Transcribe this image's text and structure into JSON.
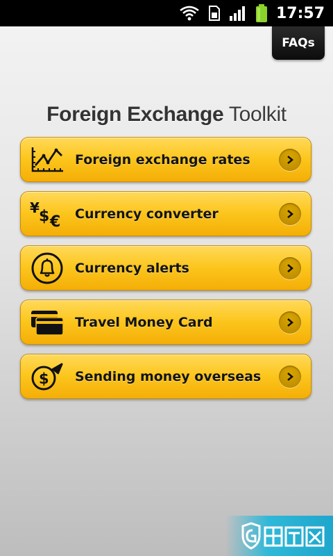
{
  "status_bar": {
    "time": "17:57",
    "icons": [
      "wifi-icon",
      "sim-icon",
      "signal-icon",
      "battery-icon"
    ]
  },
  "header": {
    "faqs_label": "FAQs"
  },
  "title": {
    "bold": "Foreign Exchange",
    "light": "Toolkit"
  },
  "menu": {
    "items": [
      {
        "label": "Foreign exchange rates",
        "icon": "line-chart-icon"
      },
      {
        "label": "Currency converter",
        "icon": "currency-symbols-icon"
      },
      {
        "label": "Currency alerts",
        "icon": "bell-icon"
      },
      {
        "label": "Travel Money Card",
        "icon": "cards-icon"
      },
      {
        "label": "Sending money overseas",
        "icon": "dollar-send-icon"
      }
    ]
  },
  "colors": {
    "button_top": "#ffd95a",
    "button_bottom": "#f4ae07",
    "status_bar": "#000000",
    "battery": "#8bd12b"
  }
}
